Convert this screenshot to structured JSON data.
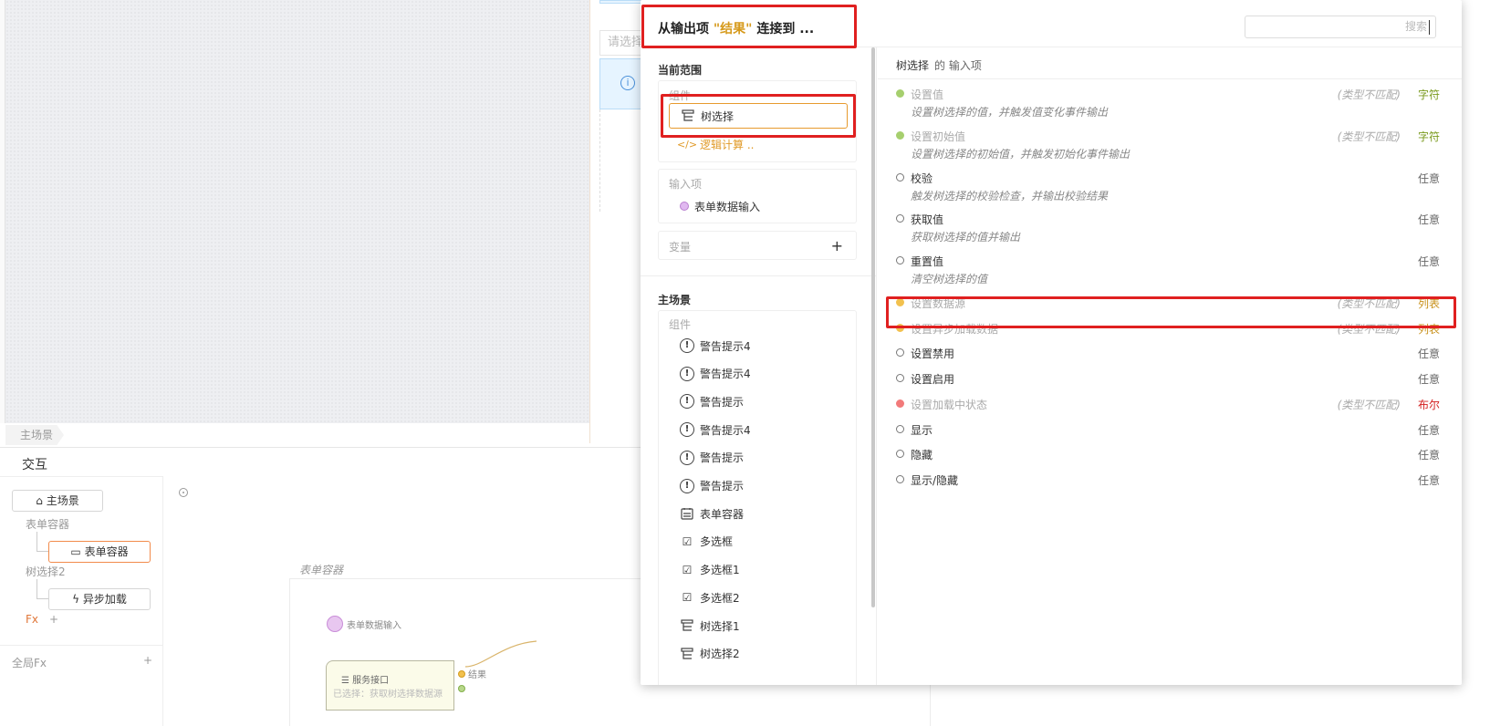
{
  "canvas": {
    "select_placeholder": "请选择",
    "scene_tab": "主场景"
  },
  "interaction": {
    "title": "交互",
    "main_scene_button": "主场景",
    "form_container_label": "表单容器",
    "form_container_node": "表单容器",
    "tree_select2_label": "树选择2",
    "async_load_node": "异步加载",
    "fx_label": "Fx",
    "global_fx_label": "全局Fx",
    "plus": "+",
    "container_title": "表单容器",
    "input_node_label": "表单数据输入",
    "service_title": "服务接口",
    "service_subtitle": "已选择：获取树选择数据源",
    "output_port_label": "结果"
  },
  "popup": {
    "title_prefix": "从输出项 ",
    "title_highlight": "\"结果\"",
    "title_suffix": " 连接到 ...",
    "search_placeholder": "搜索",
    "current_scope": "当前范围",
    "components_label": "组件",
    "scope_components": [
      {
        "icon": "tree-icon",
        "label": "树选择",
        "selected": true
      },
      {
        "icon": "code-icon",
        "label": "逻辑计算 ..",
        "selected": false
      }
    ],
    "inputs_label": "输入项",
    "input_items": [
      "表单数据输入"
    ],
    "variables_label": "变量",
    "main_scene": "主场景",
    "main_components_label": "组件",
    "main_components": [
      {
        "icon": "warning-icon",
        "label": "警告提示4"
      },
      {
        "icon": "warning-icon",
        "label": "警告提示4"
      },
      {
        "icon": "warning-icon",
        "label": "警告提示"
      },
      {
        "icon": "warning-icon",
        "label": "警告提示4"
      },
      {
        "icon": "warning-icon",
        "label": "警告提示"
      },
      {
        "icon": "warning-icon",
        "label": "警告提示"
      },
      {
        "icon": "form-icon",
        "label": "表单容器"
      },
      {
        "icon": "checkbox-icon",
        "label": "多选框"
      },
      {
        "icon": "checkbox-icon",
        "label": "多选框1"
      },
      {
        "icon": "checkbox-icon",
        "label": "多选框2"
      },
      {
        "icon": "tree-icon",
        "label": "树选择1"
      },
      {
        "icon": "tree-icon",
        "label": "树选择2"
      }
    ],
    "right_title": "树选择",
    "right_title_suffix": "的 输入项",
    "inputs": [
      {
        "name": "设置值",
        "desc": "设置树选择的值，并触发值变化事件输出",
        "note": "(类型不匹配)",
        "type": "字符",
        "dot": "#a6cf6e",
        "type_color": "#7a9a1e",
        "mismatch": true
      },
      {
        "name": "设置初始值",
        "desc": "设置树选择的初始值，并触发初始化事件输出",
        "note": "(类型不匹配)",
        "type": "字符",
        "dot": "#a6cf6e",
        "type_color": "#7a9a1e",
        "mismatch": true
      },
      {
        "name": "校验",
        "desc": "触发树选择的校验检查，并输出校验结果",
        "note": "",
        "type": "任意",
        "dot": "#ffffff",
        "type_color": "#666666",
        "mismatch": false
      },
      {
        "name": "获取值",
        "desc": "获取树选择的值并输出",
        "note": "",
        "type": "任意",
        "dot": "#ffffff",
        "type_color": "#666666",
        "mismatch": false
      },
      {
        "name": "重置值",
        "desc": "清空树选择的值",
        "note": "",
        "type": "任意",
        "dot": "#ffffff",
        "type_color": "#666666",
        "mismatch": false
      },
      {
        "name": "设置数据源",
        "desc": "",
        "note": "(类型不匹配)",
        "type": "列表",
        "dot": "#f2c14e",
        "type_color": "#c8901a",
        "mismatch": true
      },
      {
        "name": "设置异步加载数据",
        "desc": "",
        "note": "(类型不匹配)",
        "type": "列表",
        "dot": "#f2c14e",
        "type_color": "#c8901a",
        "mismatch": true
      },
      {
        "name": "设置禁用",
        "desc": "",
        "note": "",
        "type": "任意",
        "dot": "#ffffff",
        "type_color": "#666666",
        "mismatch": false
      },
      {
        "name": "设置启用",
        "desc": "",
        "note": "",
        "type": "任意",
        "dot": "#ffffff",
        "type_color": "#666666",
        "mismatch": false
      },
      {
        "name": "设置加载中状态",
        "desc": "",
        "note": "(类型不匹配)",
        "type": "布尔",
        "dot": "#f27a7a",
        "type_color": "#d42020",
        "mismatch": true
      },
      {
        "name": "显示",
        "desc": "",
        "note": "",
        "type": "任意",
        "dot": "#ffffff",
        "type_color": "#666666",
        "mismatch": false
      },
      {
        "name": "隐藏",
        "desc": "",
        "note": "",
        "type": "任意",
        "dot": "#ffffff",
        "type_color": "#666666",
        "mismatch": false
      },
      {
        "name": "显示/隐藏",
        "desc": "",
        "note": "",
        "type": "任意",
        "dot": "#ffffff",
        "type_color": "#666666",
        "mismatch": false
      }
    ]
  }
}
